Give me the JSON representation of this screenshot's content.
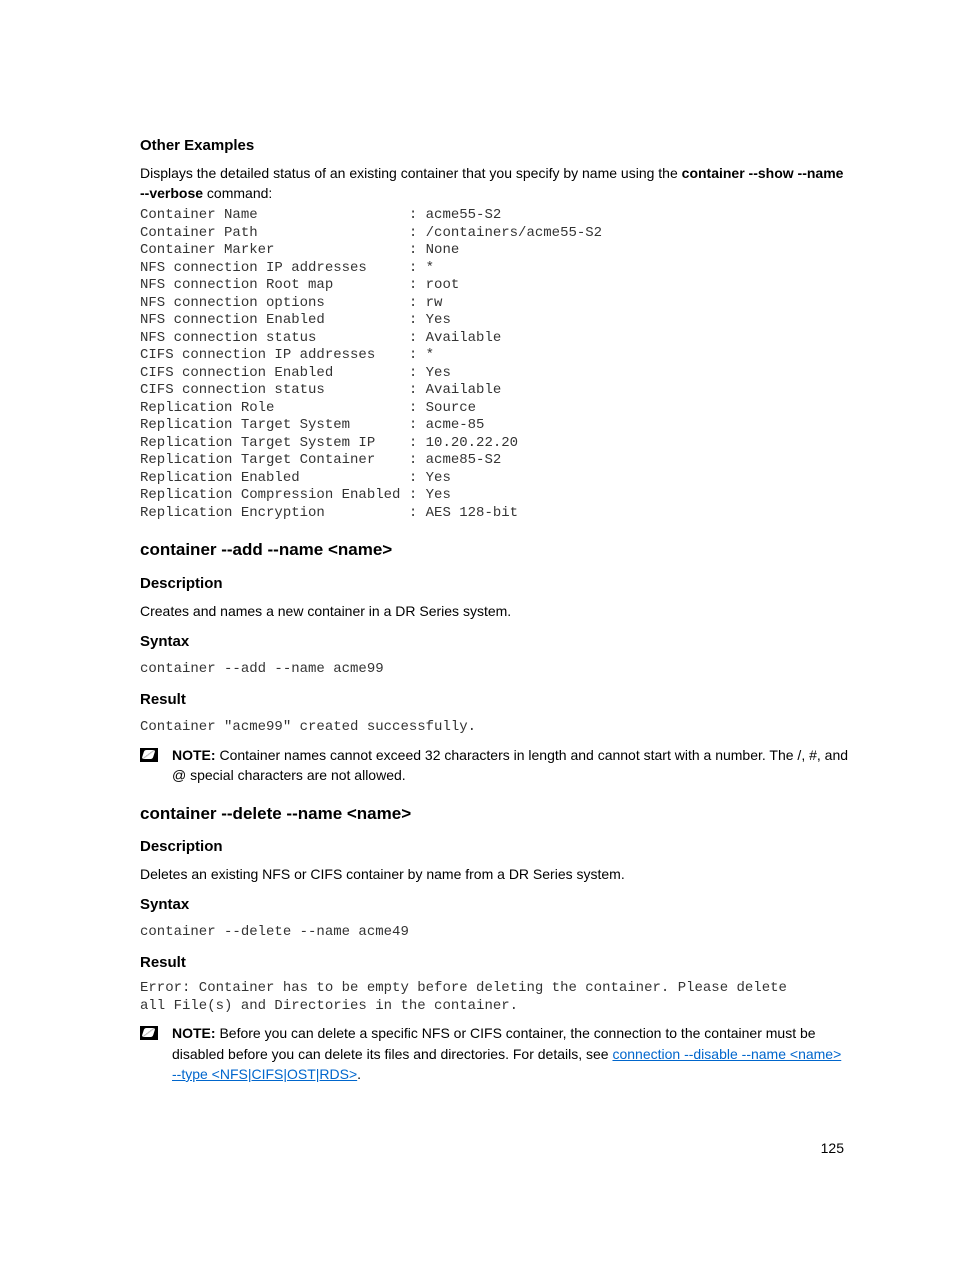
{
  "s1": {
    "title": "Other Examples",
    "intro_1": "Displays the detailed status of an existing container that you specify by name using the ",
    "intro_bold": "container --show --name --verbose",
    "intro_2": " command:",
    "code": "Container Name                  : acme55-S2\nContainer Path                  : /containers/acme55-S2\nContainer Marker                : None\nNFS connection IP addresses     : *\nNFS connection Root map         : root\nNFS connection options          : rw\nNFS connection Enabled          : Yes\nNFS connection status           : Available\nCIFS connection IP addresses    : *\nCIFS connection Enabled         : Yes\nCIFS connection status          : Available\nReplication Role                : Source\nReplication Target System       : acme-85\nReplication Target System IP    : 10.20.22.20\nReplication Target Container    : acme85-S2\nReplication Enabled             : Yes\nReplication Compression Enabled : Yes\nReplication Encryption          : AES 128-bit"
  },
  "s2": {
    "title": "container --add --name <name>",
    "desc_h": "Description",
    "desc": "Creates and names a new container in a DR Series system.",
    "syntax_h": "Syntax",
    "syntax": "container --add --name acme99",
    "result_h": "Result",
    "result": "Container \"acme99\" created successfully.",
    "note_label": "NOTE:",
    "note": " Container names cannot exceed 32 characters in length and cannot start with a number. The /, #, and @ special characters are not allowed."
  },
  "s3": {
    "title": "container --delete --name <name>",
    "desc_h": "Description",
    "desc": "Deletes an existing NFS or CIFS container by name from a DR Series system.",
    "syntax_h": "Syntax",
    "syntax": "container --delete --name acme49",
    "result_h": "Result",
    "result": "Error: Container has to be empty before deleting the container. Please delete\nall File(s) and Directories in the container.",
    "note_label": "NOTE:",
    "note_1": " Before you can delete a specific NFS or CIFS container, the connection to the container must be disabled before you can delete its files and directories. For details, see ",
    "note_link": "connection --disable --name <name> --type <NFS|CIFS|OST|RDS>",
    "note_2": "."
  },
  "page_number": "125"
}
